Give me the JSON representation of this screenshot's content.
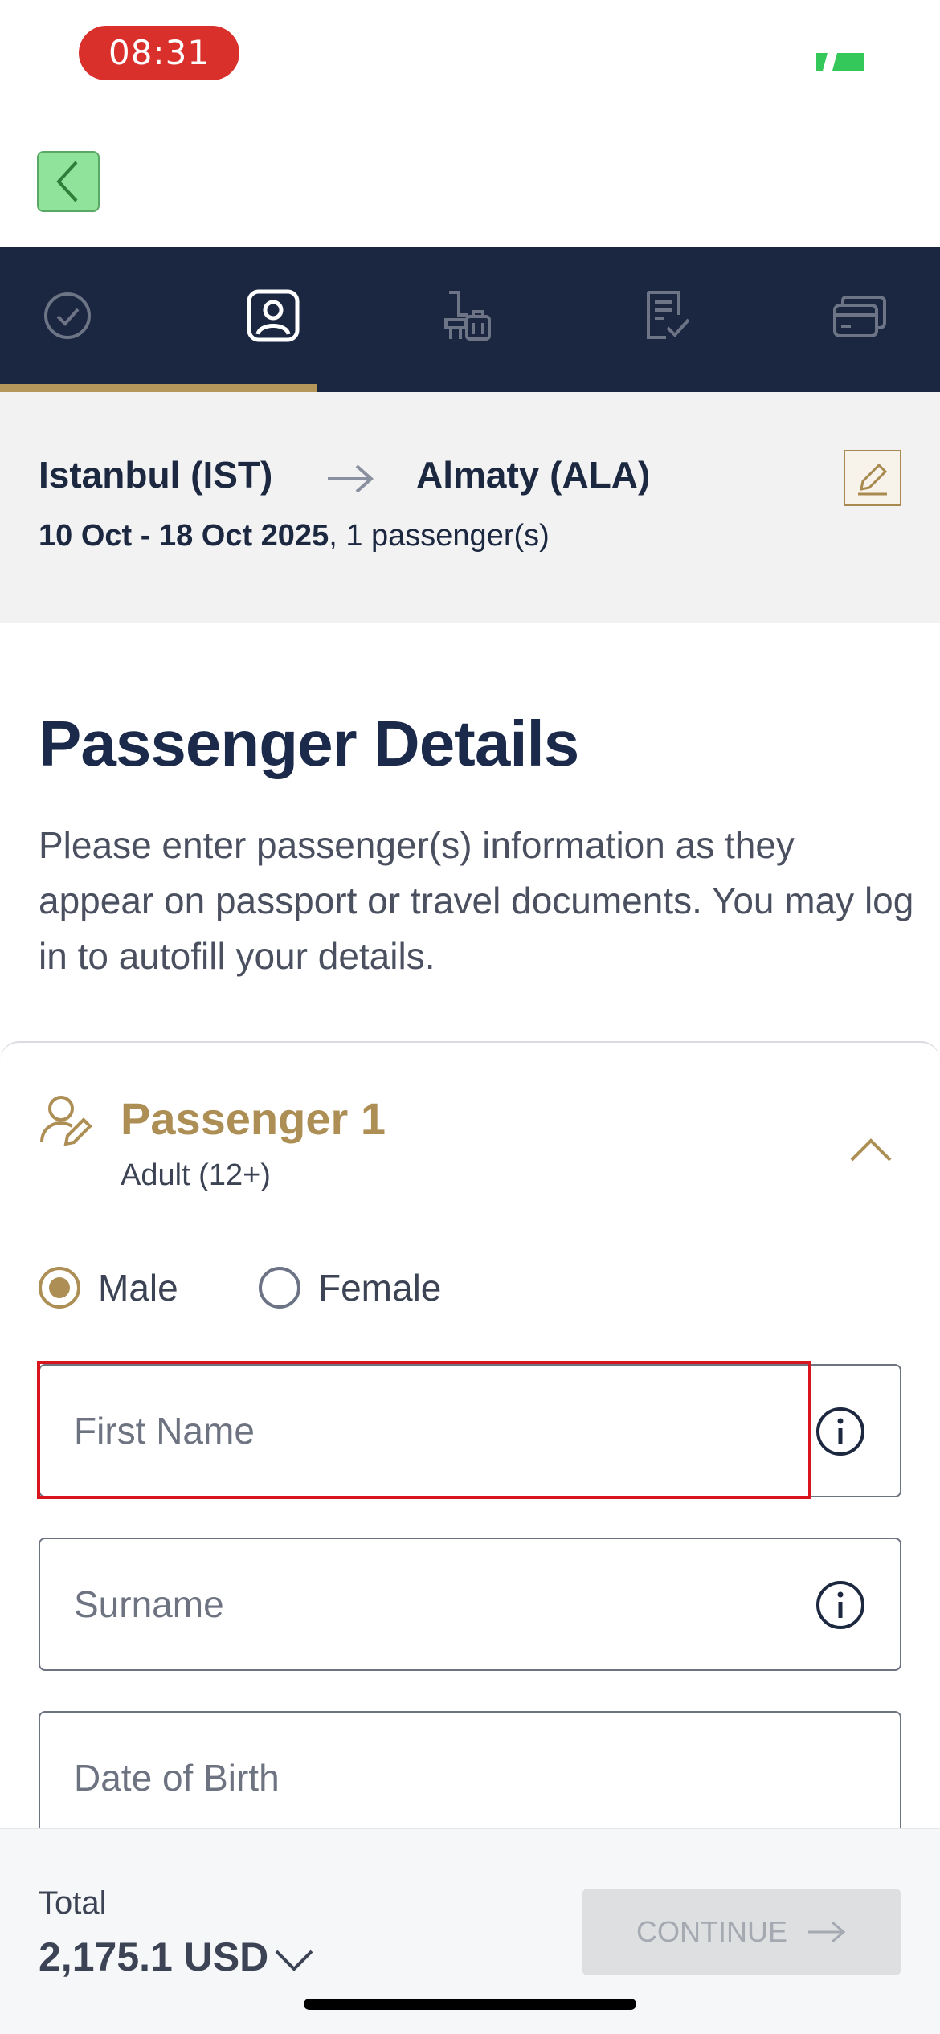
{
  "status_bar": {
    "time": "08:31"
  },
  "route": {
    "from": "Istanbul (IST)",
    "to": "Almaty (ALA)",
    "dates": "10 Oct - 18 Oct 2025",
    "passengers": ", 1 passenger(s)"
  },
  "page": {
    "title": "Passenger Details",
    "description": "Please enter passenger(s) information as they appear on passport or travel documents. You may log in to autofill your details."
  },
  "passenger": {
    "title": "Passenger 1",
    "type": "Adult (12+)",
    "gender_options": [
      {
        "label": "Male",
        "selected": true
      },
      {
        "label": "Female",
        "selected": false
      }
    ],
    "fields": {
      "first_name": {
        "placeholder": "First Name",
        "value": ""
      },
      "surname": {
        "placeholder": "Surname",
        "value": ""
      },
      "dob": {
        "placeholder": "Date of Birth",
        "value": ""
      }
    }
  },
  "footer": {
    "total_label": "Total",
    "total_amount": "2,175.1 USD",
    "continue_label": "CONTINUE"
  },
  "colors": {
    "navy": "#1b2740",
    "gold": "#ad8f55",
    "highlight": "#d8141c"
  }
}
